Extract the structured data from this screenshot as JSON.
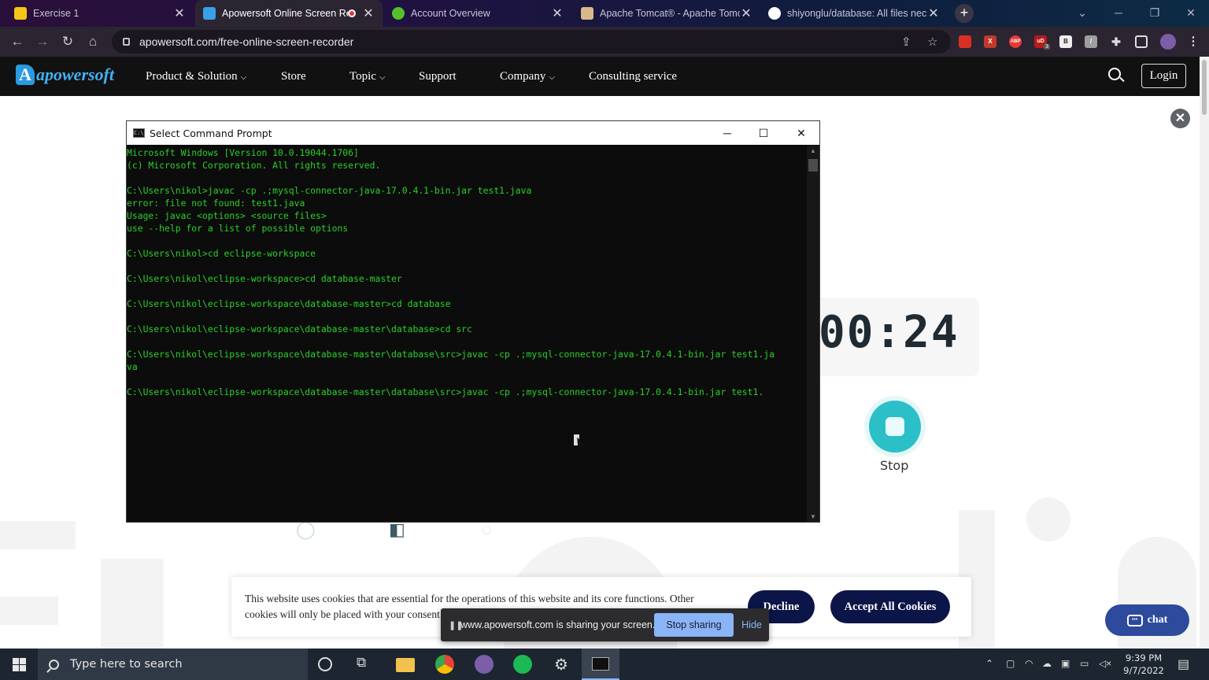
{
  "browser": {
    "tabs": [
      {
        "title": "Exercise 1",
        "favicon_color": "#f5c518",
        "active": false
      },
      {
        "title": "Apowersoft Online Screen Re",
        "favicon_color": "#3aa0e8",
        "active": true,
        "recording": true
      },
      {
        "title": "Account Overview",
        "favicon_color": "#56c02b",
        "active": false
      },
      {
        "title": "Apache Tomcat® - Apache Tomc",
        "favicon_color": "#d9b88a",
        "active": false
      },
      {
        "title": "shiyonglu/database: All files nec",
        "favicon_color": "#ffffff",
        "active": false
      }
    ],
    "new_tab_icon": "+",
    "url": "apowersoft.com/free-online-screen-recorder",
    "extensions": [
      {
        "name": "ext-red-icon",
        "label": "",
        "color": "#d93025"
      },
      {
        "name": "ext-x-icon",
        "label": "X",
        "color": "#c0392b"
      },
      {
        "name": "adblock-icon",
        "label": "ABP",
        "color": "#e53935"
      },
      {
        "name": "ublock-icon",
        "label": "uD",
        "color": "#b71c1c"
      },
      {
        "name": "ext-b-icon",
        "label": "B",
        "color": "#eeeeee"
      },
      {
        "name": "ext-pencil-icon",
        "label": "/",
        "color": "#9e9e9e"
      }
    ],
    "ublock_count": "3"
  },
  "site": {
    "logo_text": "apowersoft",
    "nav": [
      {
        "label": "Product & Solution",
        "dropdown": true
      },
      {
        "label": "Store",
        "dropdown": false
      },
      {
        "label": "Topic",
        "dropdown": true
      },
      {
        "label": "Support",
        "dropdown": false
      },
      {
        "label": "Company",
        "dropdown": true
      },
      {
        "label": "Consulting service",
        "dropdown": false
      }
    ],
    "login_label": "Login",
    "timer": "00:24",
    "stop_label": "Stop",
    "chat_label": "chat"
  },
  "cmd": {
    "title": "Select Command Prompt",
    "lines": [
      "Microsoft Windows [Version 10.0.19044.1706]",
      "(c) Microsoft Corporation. All rights reserved.",
      "",
      "C:\\Users\\nikol>javac -cp .;mysql-connector-java-17.0.4.1-bin.jar test1.java",
      "error: file not found: test1.java",
      "Usage: javac <options> <source files>",
      "use --help for a list of possible options",
      "",
      "C:\\Users\\nikol>cd eclipse-workspace",
      "",
      "C:\\Users\\nikol\\eclipse-workspace>cd database-master",
      "",
      "C:\\Users\\nikol\\eclipse-workspace\\database-master>cd database",
      "",
      "C:\\Users\\nikol\\eclipse-workspace\\database-master\\database>cd src",
      "",
      "C:\\Users\\nikol\\eclipse-workspace\\database-master\\database\\src>javac -cp .;mysql-connector-java-17.0.4.1-bin.jar test1.ja",
      "va",
      "",
      "C:\\Users\\nikol\\eclipse-workspace\\database-master\\database\\src>javac -cp .;mysql-connector-java-17.0.4.1-bin.jar test1."
    ],
    "text_color": "#2ad02a"
  },
  "cookie": {
    "text": "This website uses cookies that are essential for the operations of this website and its core functions. Other cookies will only be placed with your consent.",
    "decline_label": "Decline",
    "accept_label": "Accept All Cookies"
  },
  "sharebar": {
    "message": "www.apowersoft.com is sharing your screen.",
    "stop_label": "Stop sharing",
    "hide_label": "Hide"
  },
  "taskbar": {
    "search_placeholder": "Type here to search",
    "time": "9:39 PM",
    "date": "9/7/2022"
  }
}
